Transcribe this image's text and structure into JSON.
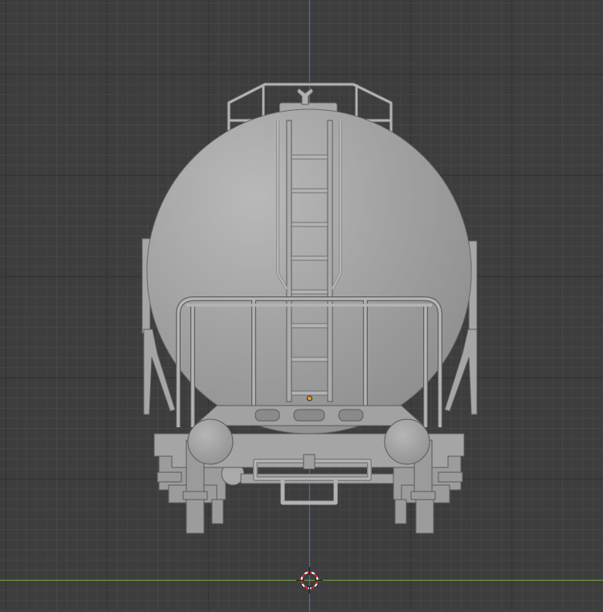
{
  "viewport": {
    "view": "front-orthographic",
    "background": "#3d3d3d",
    "grid_minor_color": "#474747",
    "grid_major_color": "#333333",
    "z_axis_color": "#3a6fb4",
    "x_axis_color": "#6e9a3c",
    "origin_dot_color": "#e79a22",
    "cursor_colors": [
      "#e02424",
      "#ffffff"
    ]
  },
  "scene": {
    "object_icon": "tank-wagon-model-icon",
    "cursor_icon": "3d-cursor-icon",
    "origin_icon": "object-origin-icon",
    "model_color": "#a9a9a9"
  }
}
